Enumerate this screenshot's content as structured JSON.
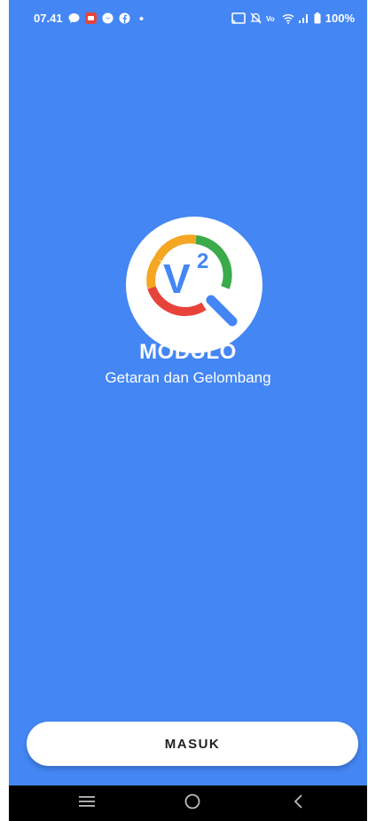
{
  "status_bar": {
    "time": "07.41",
    "battery": "100%",
    "left_icons": [
      "chat-bubble-icon",
      "notification-app-icon",
      "messenger-icon",
      "facebook-icon",
      "more-dot-icon"
    ],
    "right_icons": [
      "cast-icon",
      "mute-icon",
      "volte-icon",
      "wifi-icon",
      "signal-icon",
      "battery-icon"
    ]
  },
  "app": {
    "title": "MODULO",
    "subtitle": "Getaran dan Gelombang",
    "logo_text": "V",
    "logo_superscript": "2"
  },
  "actions": {
    "login_label": "MASUK"
  },
  "nav_bar": {
    "icons": [
      "recent-apps-icon",
      "home-icon",
      "back-icon"
    ]
  },
  "colors": {
    "background": "#4486F4",
    "logo_orange": "#F5A623",
    "logo_green": "#3AAA4A",
    "logo_red": "#E8433B",
    "logo_blue": "#4486F4"
  }
}
